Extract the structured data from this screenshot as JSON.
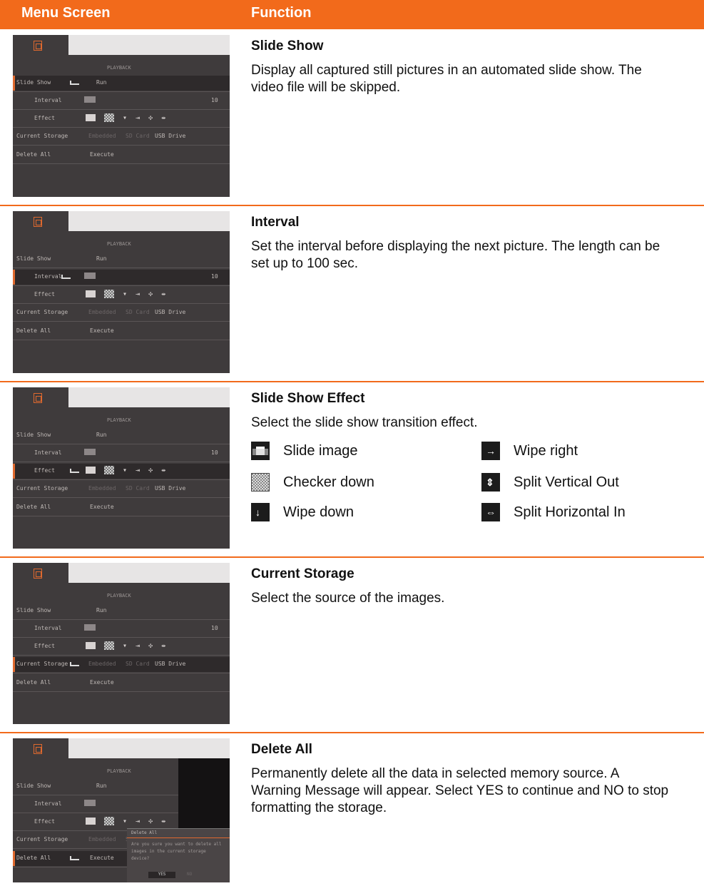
{
  "header": {
    "col1": "Menu Screen",
    "col2": "Function"
  },
  "screen": {
    "title": "PLAYBACK",
    "items": {
      "slideshow": "Slide Show",
      "slideshow_value": "Run",
      "interval": "Interval",
      "interval_value": "10",
      "effect": "Effect",
      "storage": "Current Storage",
      "storage_opts": [
        "Embedded",
        "SD Card",
        "USB Drive"
      ],
      "delete": "Delete All",
      "delete_value": "Execute"
    },
    "dialog": {
      "title": "Delete All",
      "message": [
        "Are you sure you want to delete all",
        "images in the current storage",
        "device?"
      ],
      "yes": "YES",
      "no": "NO"
    }
  },
  "rows": [
    {
      "title": "Slide Show",
      "desc": "Display all captured still pictures in an automated slide show. The video file will be skipped."
    },
    {
      "title": "Interval",
      "desc": "Set the interval before displaying the next picture. The length can be set up to 100 sec."
    },
    {
      "title": "Slide Show Effect",
      "desc": "Select the slide show transition effect.",
      "effects": [
        {
          "label": "Slide image",
          "icon": "slide-image-icon"
        },
        {
          "label": "Checker down",
          "icon": "checker-down-icon"
        },
        {
          "label": "Wipe down",
          "icon": "wipe-down-icon"
        },
        {
          "label": "Wipe right",
          "icon": "wipe-right-icon"
        },
        {
          "label": "Split Vertical Out",
          "icon": "split-vertical-out-icon"
        },
        {
          "label": "Split Horizontal In",
          "icon": "split-horizontal-in-icon"
        }
      ]
    },
    {
      "title": "Current Storage",
      "desc": "Select the source of the images."
    },
    {
      "title": "Delete All",
      "desc": "Permanently delete all the data in selected memory source. A Warning Message will appear. Select YES to continue and NO to stop formatting the storage."
    }
  ],
  "colors": {
    "accent": "#f26a1b",
    "screen_bg": "#3f3b3c"
  }
}
